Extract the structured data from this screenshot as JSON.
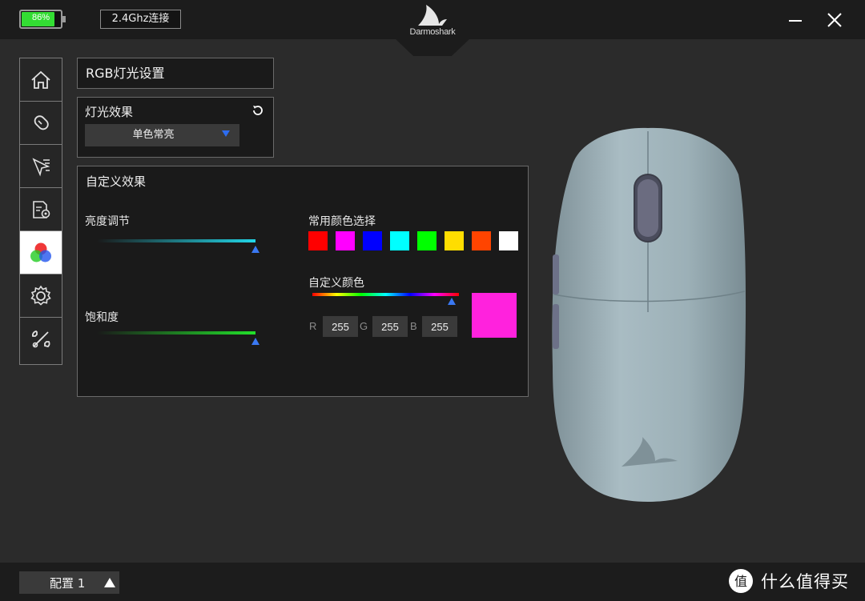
{
  "titlebar": {
    "battery_percent": 86,
    "battery_label": "86%",
    "connection": "2.4Ghz连接",
    "logo_text": "Darmoshark"
  },
  "sidebar": {
    "items": [
      {
        "icon": "home-icon"
      },
      {
        "icon": "mouse-icon"
      },
      {
        "icon": "cursor-icon"
      },
      {
        "icon": "macro-settings-icon"
      },
      {
        "icon": "rgb-icon",
        "active": true
      },
      {
        "icon": "gear-icon"
      },
      {
        "icon": "tools-icon"
      }
    ]
  },
  "panel": {
    "title": "RGB灯光设置",
    "effect_label": "灯光效果",
    "effect_value": "单色常亮"
  },
  "custom": {
    "title": "自定义效果",
    "brightness_label": "亮度调节",
    "brightness_value": 1.0,
    "saturation_label": "饱和度",
    "saturation_value": 1.0,
    "common_colors_label": "常用颜色选择",
    "common_colors": [
      "#ff0000",
      "#ff00ff",
      "#0000ff",
      "#00ffff",
      "#00ff00",
      "#ffdd00",
      "#ff4400",
      "#ffffff"
    ],
    "custom_color_label": "自定义颜色",
    "hue_position": 0.95,
    "r_label": "R",
    "g_label": "G",
    "b_label": "B",
    "r": "255",
    "g": "255",
    "b": "255",
    "preview_color": "#ff22dd"
  },
  "bottom": {
    "profile_label": "配置 1",
    "watermark": "什么值得买"
  },
  "colors": {
    "accent": "#3a78f2",
    "mouse_body": "#9fb2b9"
  }
}
